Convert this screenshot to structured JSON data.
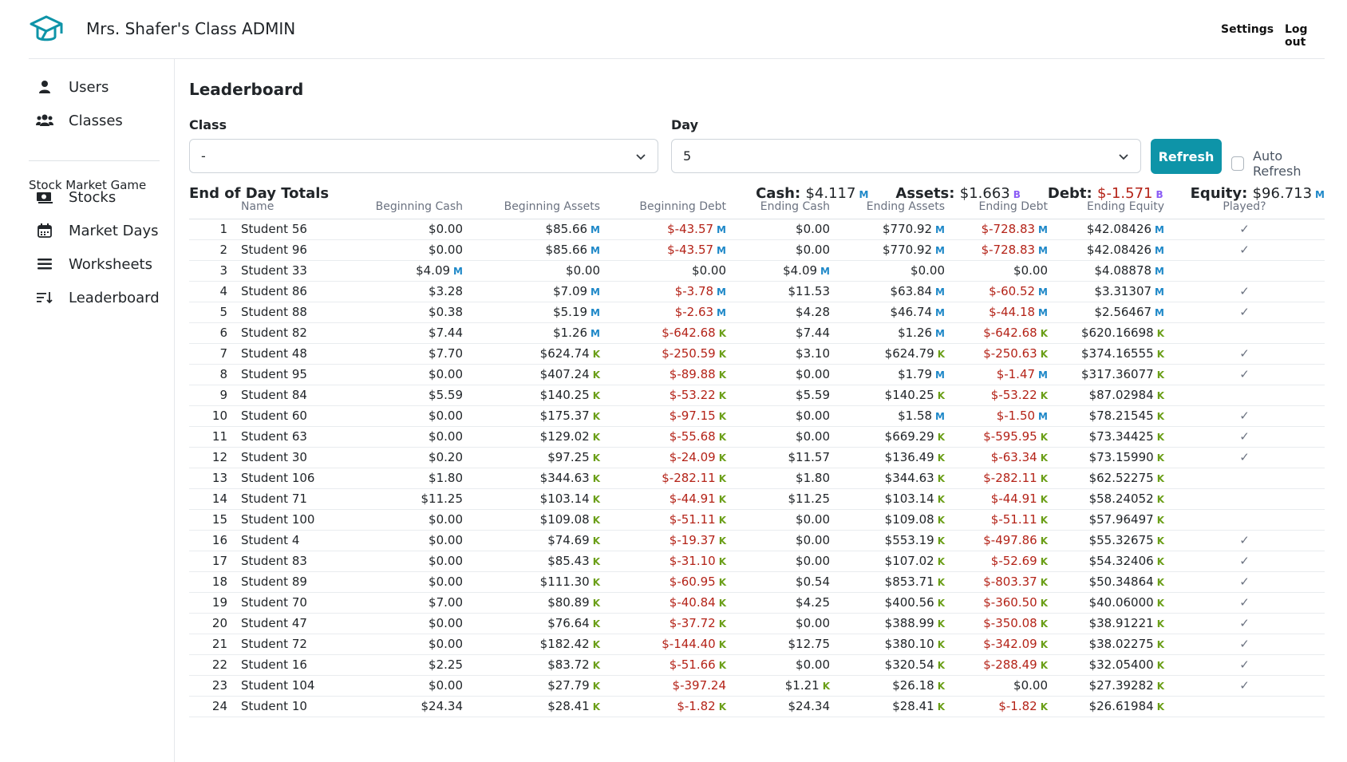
{
  "header": {
    "title": "Mrs. Shafer's Class ADMIN",
    "settings": "Settings",
    "logout": "Log out",
    "logo_icon": "graduation-cap-icon"
  },
  "sidebar": {
    "items": [
      {
        "label": "Users",
        "icon": "user-icon"
      },
      {
        "label": "Classes",
        "icon": "users-icon"
      }
    ],
    "section_title": "Stock Market Game",
    "game_items": [
      {
        "label": "Stocks",
        "icon": "money-bill-icon"
      },
      {
        "label": "Market Days",
        "icon": "calendar-icon"
      },
      {
        "label": "Worksheets",
        "icon": "list-icon"
      },
      {
        "label": "Leaderboard",
        "icon": "sort-list-icon"
      }
    ]
  },
  "main": {
    "title": "Leaderboard",
    "class_label": "Class",
    "class_value": "-",
    "day_label": "Day",
    "day_value": "5",
    "refresh": "Refresh",
    "auto_refresh": "Auto Refresh",
    "totals_title": "End of Day Totals",
    "totals": [
      {
        "label": "Cash:",
        "value": "$4.117",
        "suffix": "M",
        "neg": false
      },
      {
        "label": "Assets:",
        "value": "$1.663",
        "suffix": "B",
        "neg": false
      },
      {
        "label": "Debt:",
        "value": "$-1.571",
        "suffix": "B",
        "neg": true
      },
      {
        "label": "Equity:",
        "value": "$96.713",
        "suffix": "M",
        "neg": false
      }
    ],
    "columns": [
      "",
      "Name",
      "Beginning Cash",
      "Beginning Assets",
      "Beginning Debt",
      "Ending Cash",
      "Ending Assets",
      "Ending Debt",
      "Ending Equity",
      "Played?"
    ],
    "rows": [
      [
        "1",
        "Student 56",
        "$0.00",
        "",
        "$85.66",
        "M",
        "$-43.57",
        "M",
        "$0.00",
        "",
        "$770.92",
        "M",
        "$-728.83",
        "M",
        "$42.08426",
        "M",
        true
      ],
      [
        "2",
        "Student 96",
        "$0.00",
        "",
        "$85.66",
        "M",
        "$-43.57",
        "M",
        "$0.00",
        "",
        "$770.92",
        "M",
        "$-728.83",
        "M",
        "$42.08426",
        "M",
        true
      ],
      [
        "3",
        "Student 33",
        "$4.09",
        "M",
        "$0.00",
        "",
        "$0.00",
        "",
        "$4.09",
        "M",
        "$0.00",
        "",
        "$0.00",
        "",
        "$4.08878",
        "M",
        false
      ],
      [
        "4",
        "Student 86",
        "$3.28",
        "",
        "$7.09",
        "M",
        "$-3.78",
        "M",
        "$11.53",
        "",
        "$63.84",
        "M",
        "$-60.52",
        "M",
        "$3.31307",
        "M",
        true
      ],
      [
        "5",
        "Student 88",
        "$0.38",
        "",
        "$5.19",
        "M",
        "$-2.63",
        "M",
        "$4.28",
        "",
        "$46.74",
        "M",
        "$-44.18",
        "M",
        "$2.56467",
        "M",
        true
      ],
      [
        "6",
        "Student 82",
        "$7.44",
        "",
        "$1.26",
        "M",
        "$-642.68",
        "K",
        "$7.44",
        "",
        "$1.26",
        "M",
        "$-642.68",
        "K",
        "$620.16698",
        "K",
        false
      ],
      [
        "7",
        "Student 48",
        "$7.70",
        "",
        "$624.74",
        "K",
        "$-250.59",
        "K",
        "$3.10",
        "",
        "$624.79",
        "K",
        "$-250.63",
        "K",
        "$374.16555",
        "K",
        true
      ],
      [
        "8",
        "Student 95",
        "$0.00",
        "",
        "$407.24",
        "K",
        "$-89.88",
        "K",
        "$0.00",
        "",
        "$1.79",
        "M",
        "$-1.47",
        "M",
        "$317.36077",
        "K",
        true
      ],
      [
        "9",
        "Student 84",
        "$5.59",
        "",
        "$140.25",
        "K",
        "$-53.22",
        "K",
        "$5.59",
        "",
        "$140.25",
        "K",
        "$-53.22",
        "K",
        "$87.02984",
        "K",
        false
      ],
      [
        "10",
        "Student 60",
        "$0.00",
        "",
        "$175.37",
        "K",
        "$-97.15",
        "K",
        "$0.00",
        "",
        "$1.58",
        "M",
        "$-1.50",
        "M",
        "$78.21545",
        "K",
        true
      ],
      [
        "11",
        "Student 63",
        "$0.00",
        "",
        "$129.02",
        "K",
        "$-55.68",
        "K",
        "$0.00",
        "",
        "$669.29",
        "K",
        "$-595.95",
        "K",
        "$73.34425",
        "K",
        true
      ],
      [
        "12",
        "Student 30",
        "$0.20",
        "",
        "$97.25",
        "K",
        "$-24.09",
        "K",
        "$11.57",
        "",
        "$136.49",
        "K",
        "$-63.34",
        "K",
        "$73.15990",
        "K",
        true
      ],
      [
        "13",
        "Student 106",
        "$1.80",
        "",
        "$344.63",
        "K",
        "$-282.11",
        "K",
        "$1.80",
        "",
        "$344.63",
        "K",
        "$-282.11",
        "K",
        "$62.52275",
        "K",
        false
      ],
      [
        "14",
        "Student 71",
        "$11.25",
        "",
        "$103.14",
        "K",
        "$-44.91",
        "K",
        "$11.25",
        "",
        "$103.14",
        "K",
        "$-44.91",
        "K",
        "$58.24052",
        "K",
        false
      ],
      [
        "15",
        "Student 100",
        "$0.00",
        "",
        "$109.08",
        "K",
        "$-51.11",
        "K",
        "$0.00",
        "",
        "$109.08",
        "K",
        "$-51.11",
        "K",
        "$57.96497",
        "K",
        false
      ],
      [
        "16",
        "Student 4",
        "$0.00",
        "",
        "$74.69",
        "K",
        "$-19.37",
        "K",
        "$0.00",
        "",
        "$553.19",
        "K",
        "$-497.86",
        "K",
        "$55.32675",
        "K",
        true
      ],
      [
        "17",
        "Student 83",
        "$0.00",
        "",
        "$85.43",
        "K",
        "$-31.10",
        "K",
        "$0.00",
        "",
        "$107.02",
        "K",
        "$-52.69",
        "K",
        "$54.32406",
        "K",
        true
      ],
      [
        "18",
        "Student 89",
        "$0.00",
        "",
        "$111.30",
        "K",
        "$-60.95",
        "K",
        "$0.54",
        "",
        "$853.71",
        "K",
        "$-803.37",
        "K",
        "$50.34864",
        "K",
        true
      ],
      [
        "19",
        "Student 70",
        "$7.00",
        "",
        "$80.89",
        "K",
        "$-40.84",
        "K",
        "$4.25",
        "",
        "$400.56",
        "K",
        "$-360.50",
        "K",
        "$40.06000",
        "K",
        true
      ],
      [
        "20",
        "Student 47",
        "$0.00",
        "",
        "$76.64",
        "K",
        "$-37.72",
        "K",
        "$0.00",
        "",
        "$388.99",
        "K",
        "$-350.08",
        "K",
        "$38.91221",
        "K",
        true
      ],
      [
        "21",
        "Student 72",
        "$0.00",
        "",
        "$182.42",
        "K",
        "$-144.40",
        "K",
        "$12.75",
        "",
        "$380.10",
        "K",
        "$-342.09",
        "K",
        "$38.02275",
        "K",
        true
      ],
      [
        "22",
        "Student 16",
        "$2.25",
        "",
        "$83.72",
        "K",
        "$-51.66",
        "K",
        "$0.00",
        "",
        "$320.54",
        "K",
        "$-288.49",
        "K",
        "$32.05400",
        "K",
        true
      ],
      [
        "23",
        "Student 104",
        "$0.00",
        "",
        "$27.79",
        "K",
        "$-397.24",
        "",
        "$1.21",
        "K",
        "$26.18",
        "K",
        "$0.00",
        "",
        "$27.39282",
        "K",
        true
      ],
      [
        "24",
        "Student 10",
        "$24.34",
        "",
        "$28.41",
        "K",
        "$-1.82",
        "K",
        "$24.34",
        "",
        "$28.41",
        "K",
        "$-1.82",
        "K",
        "$26.61984",
        "K",
        false
      ]
    ]
  }
}
